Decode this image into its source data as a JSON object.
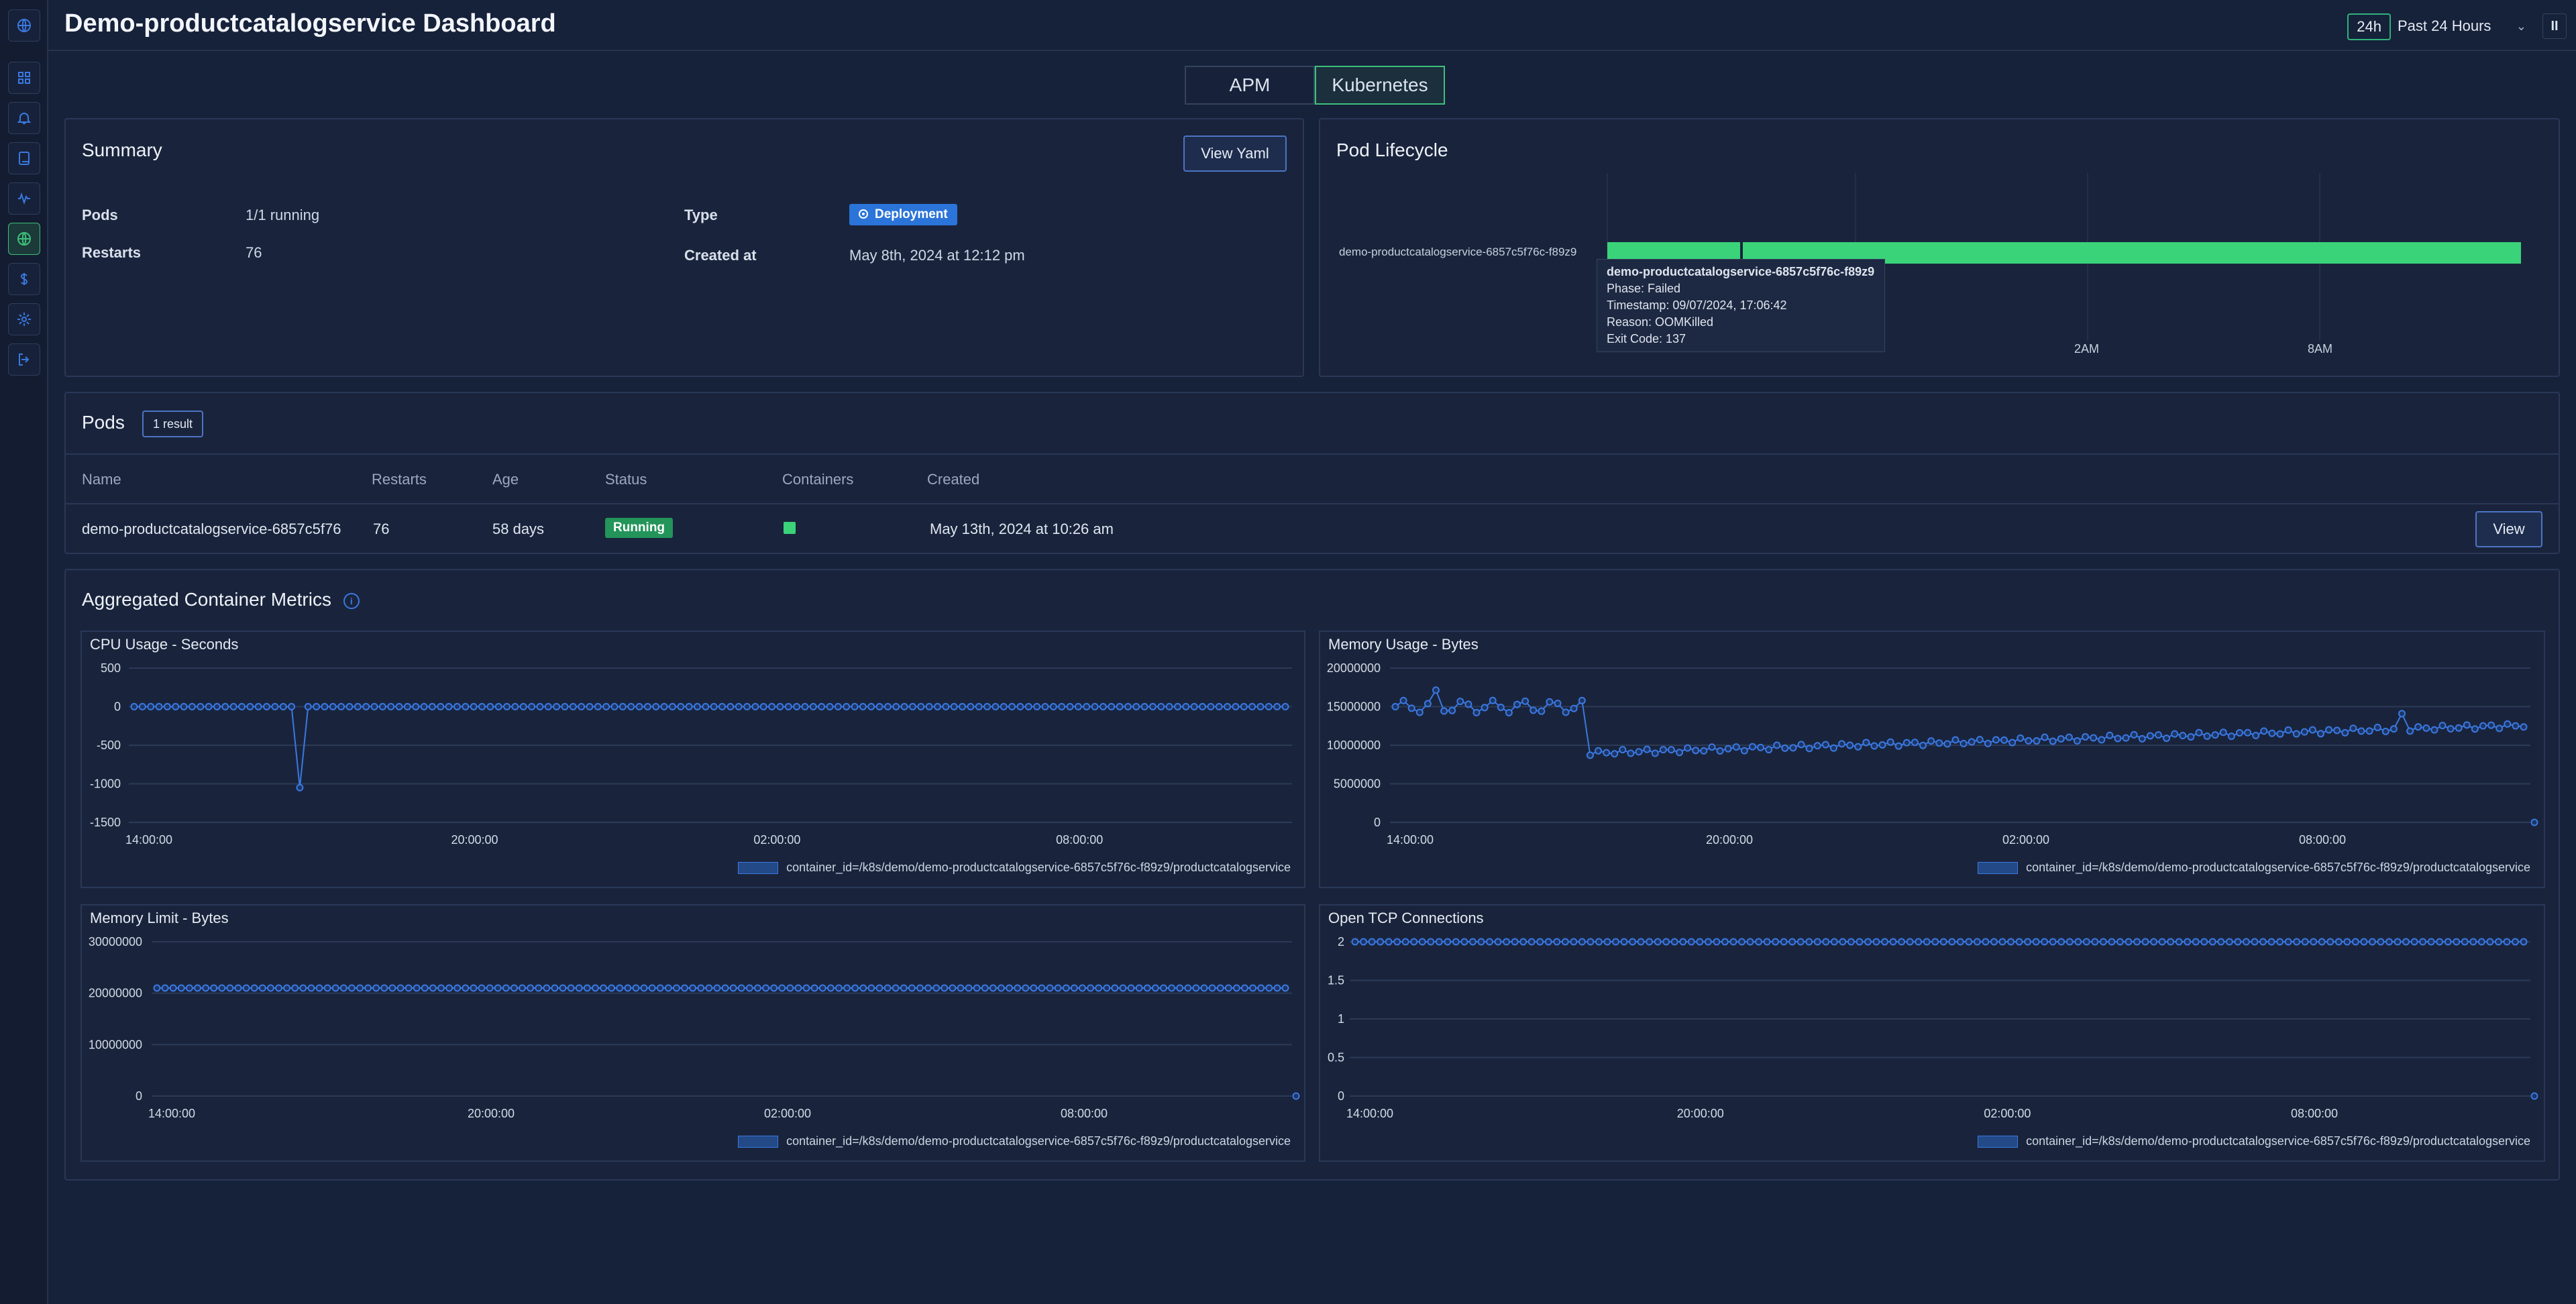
{
  "header": {
    "title": "Demo-productcatalogservice Dashboard",
    "range_badge": "24h",
    "range_label": "Past 24 Hours",
    "pause_label": "II"
  },
  "tabs": [
    "APM",
    "Kubernetes"
  ],
  "summary": {
    "title": "Summary",
    "view_yaml": "View Yaml",
    "pods_label": "Pods",
    "pods_value": "1/1 running",
    "restarts_label": "Restarts",
    "restarts_value": "76",
    "type_label": "Type",
    "type_value": "Deployment",
    "created_label": "Created at",
    "created_value": "May 8th, 2024 at 12:12 pm"
  },
  "lifecycle": {
    "title": "Pod Lifecycle",
    "pod_name": "demo-productcatalogservice-6857c5f76c-f89z9",
    "ticks": [
      "2AM",
      "8AM"
    ],
    "tooltip": {
      "title": "demo-productcatalogservice-6857c5f76c-f89z9",
      "phase": "Phase: Failed",
      "timestamp": "Timestamp: 09/07/2024, 17:06:42",
      "reason": "Reason: OOMKilled",
      "exit_code": "Exit Code: 137"
    }
  },
  "pods": {
    "title": "Pods",
    "result_badge": "1 result",
    "columns": [
      "Name",
      "Restarts",
      "Age",
      "Status",
      "Containers",
      "Created"
    ],
    "row": {
      "name": "demo-productcatalogservice-6857c5f76",
      "restarts": "76",
      "age": "58 days",
      "status": "Running",
      "created": "May 13th, 2024 at 10:26 am",
      "view": "View"
    }
  },
  "metrics": {
    "title": "Aggregated Container Metrics",
    "legend": "container_id=/k8s/demo/demo-productcatalogservice-6857c5f76c-f89z9/productcatalogservice"
  },
  "colors": {
    "accent": "#3b78e0",
    "running": "#23945a",
    "lifecycle_bar": "#3ad37a",
    "active_border": "#3ec07a"
  },
  "chart_data": [
    {
      "type": "line",
      "title": "CPU Usage - Seconds",
      "x": [
        "14:00:00",
        "20:00:00",
        "02:00:00",
        "08:00:00"
      ],
      "yticks": [
        "500",
        "0",
        "-500",
        "-1000",
        "-1500"
      ],
      "ylim": [
        -1500,
        500
      ],
      "series": [
        {
          "name": "container_id=/k8s/demo/demo-productcatalogservice-6857c5f76c-f89z9/productcatalogservice",
          "values_desc": "0 throughout except dip to about -1050 near 17:00"
        }
      ]
    },
    {
      "type": "line",
      "title": "Memory Usage - Bytes",
      "x": [
        "14:00:00",
        "20:00:00",
        "02:00:00",
        "08:00:00"
      ],
      "yticks": [
        "20000000",
        "15000000",
        "10000000",
        "5000000",
        "0"
      ],
      "ylim": [
        0,
        20000000
      ],
      "series": [
        {
          "name": "container_id=/k8s/demo/demo-productcatalogservice-6857c5f76c-f89z9/productcatalogservice",
          "values_desc": "around 15000000 until ~17:00 then drops to ~9000000 and rises slowly to ~13000000"
        }
      ]
    },
    {
      "type": "line",
      "title": "Memory Limit - Bytes",
      "x": [
        "14:00:00",
        "20:00:00",
        "02:00:00",
        "08:00:00"
      ],
      "yticks": [
        "30000000",
        "20000000",
        "10000000",
        "0"
      ],
      "ylim": [
        0,
        30000000
      ],
      "series": [
        {
          "name": "container_id=/k8s/demo/demo-productcatalogservice-6857c5f76c-f89z9/productcatalogservice",
          "value": 21000000
        }
      ]
    },
    {
      "type": "line",
      "title": "Open TCP Connections",
      "x": [
        "14:00:00",
        "20:00:00",
        "02:00:00",
        "08:00:00"
      ],
      "yticks": [
        "2",
        "1.5",
        "1",
        "0.5",
        "0"
      ],
      "ylim": [
        0,
        2
      ],
      "series": [
        {
          "name": "container_id=/k8s/demo/demo-productcatalogservice-6857c5f76c-f89z9/productcatalogservice",
          "value": 2
        }
      ]
    }
  ]
}
